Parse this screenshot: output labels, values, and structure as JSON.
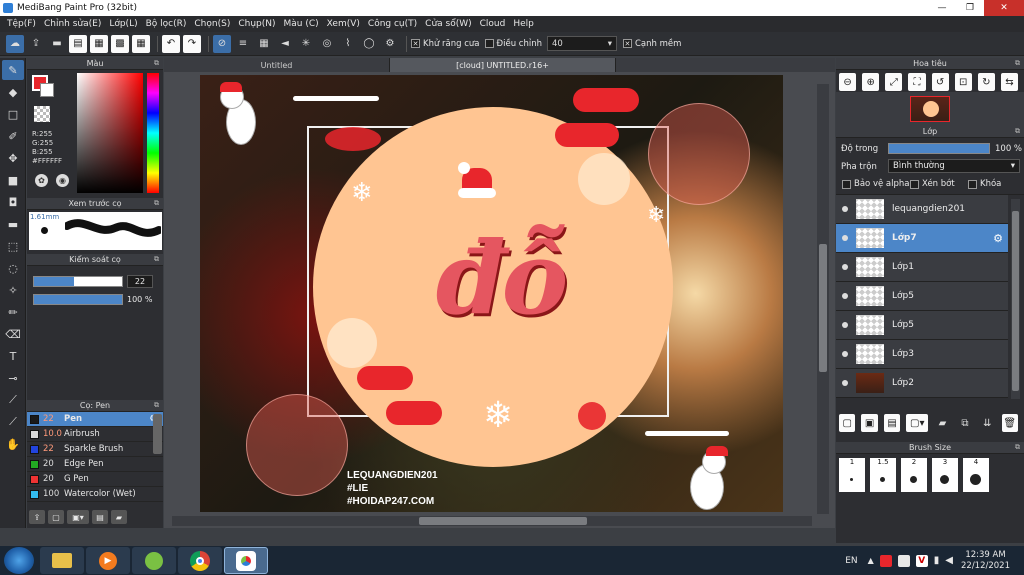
{
  "window": {
    "title": "MediBang Paint Pro (32bit)",
    "min": "—",
    "max": "❐",
    "close": "✕"
  },
  "menu": [
    "Tệp(F)",
    "Chỉnh sửa(E)",
    "Lớp(L)",
    "Bộ lọc(R)",
    "Chọn(S)",
    "Chụp(N)",
    "Màu (C)",
    "Xem(V)",
    "Công cụ(T)",
    "Cửa sổ(W)",
    "Cloud",
    "Help"
  ],
  "toolbar": {
    "antialias_label": "Khử răng cưa",
    "correction_label": "Điều chỉnh",
    "correction_value": "40",
    "sharp_label": "Cạnh mềm"
  },
  "color_panel": {
    "title": "Màu",
    "r": "R:255",
    "g": "G:255",
    "b": "B:255",
    "hex": "#FFFFFF"
  },
  "brush_preview": {
    "title": "Xem trước cọ",
    "size": "1.61mm"
  },
  "brush_control": {
    "title": "Kiểm soát cọ",
    "size": "22",
    "opacity": "100 %"
  },
  "brush_panel": {
    "title": "Cọ: Pen",
    "items": [
      {
        "size": "22",
        "name": "Pen",
        "color": "#1a1a1a"
      },
      {
        "size": "10.0",
        "name": "Airbrush",
        "color": "#d8d8d8"
      },
      {
        "size": "22",
        "name": "Sparkle Brush",
        "color": "#2244dd"
      },
      {
        "size": "20",
        "name": "Edge Pen",
        "color": "#22aa22"
      },
      {
        "size": "20",
        "name": "G Pen",
        "color": "#ee3333"
      },
      {
        "size": "100",
        "name": "Watercolor (Wet)",
        "color": "#33bbee"
      }
    ]
  },
  "tabs": {
    "tab1": "Untitled",
    "tab2": "[cloud] UNTITLED.r16+"
  },
  "canvas": {
    "wm1": "LEQUANGDIEN201",
    "wm2": "#LIE",
    "wm3": "#HOIDAP247.COM",
    "art_text": "đỗ"
  },
  "navigator": {
    "title": "Hoa tiêu"
  },
  "layer_panel": {
    "title": "Lớp",
    "opacity_label": "Độ trong",
    "opacity_value": "100 %",
    "blend_label": "Pha trộn",
    "blend_value": "Bình thường",
    "protect_alpha": "Bảo vệ alpha",
    "clipping": "Xén bớt",
    "lock": "Khóa",
    "layers": [
      "lequangdien201",
      "Lớp7",
      "Lớp1",
      "Lớp5",
      "Lớp5",
      "Lớp3",
      "Lớp2"
    ]
  },
  "brush_size": {
    "title": "Brush Size",
    "sizes": [
      "1",
      "1.5",
      "2",
      "3",
      "4"
    ]
  },
  "taskbar": {
    "lang": "EN",
    "time": "12:39 AM",
    "date": "22/12/2021"
  },
  "colors": {
    "accent": "#4c86c8",
    "peach": "#ffc592",
    "red": "#e8262c"
  }
}
